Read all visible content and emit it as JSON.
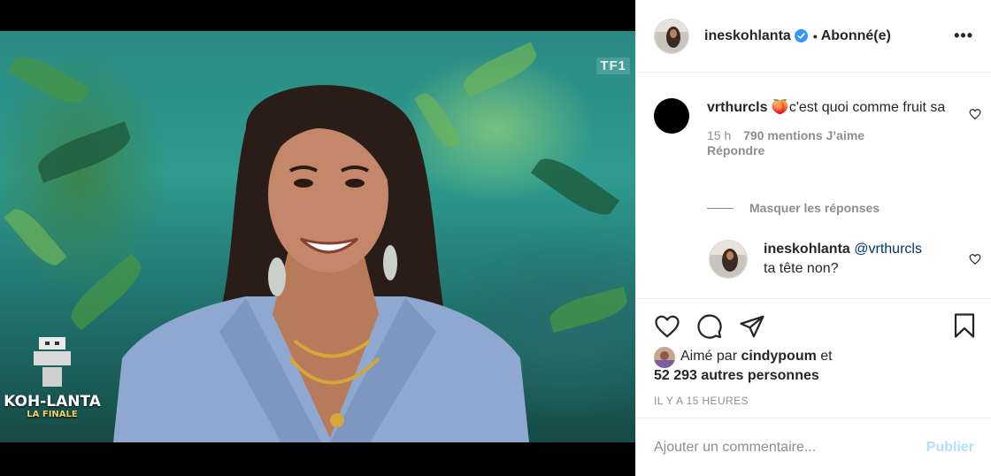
{
  "media": {
    "channel_logo": "TF1",
    "show_title": "KOH-LANTA",
    "show_subtitle": "LA FINALE"
  },
  "header": {
    "username": "ineskohlanta",
    "separator": "•",
    "follow_status": "Abonné(e)",
    "more_label": "•••"
  },
  "comments": [
    {
      "username": "vrthurcls",
      "emoji": "🍑",
      "text": "c'est quoi comme fruit sa",
      "time": "15 h",
      "likes": "790 mentions J’aime",
      "reply_label": "Répondre"
    }
  ],
  "hide_replies_label": "Masquer les réponses",
  "reply": {
    "username": "ineskohlanta",
    "mention": "@vrthurcls",
    "text": "ta tête non?"
  },
  "likes": {
    "prefix": "Aimé par",
    "user": "cindypoum",
    "conjunction": "et",
    "count": "52 293 autres personnes"
  },
  "timestamp": "IL Y A 15 HEURES",
  "add_comment": {
    "placeholder": "Ajouter un commentaire...",
    "publish_label": "Publier"
  },
  "colors": {
    "verified": "#3897f0",
    "publish_disabled": "#b2dffc",
    "text": "#262626",
    "muted": "#8e8e8e",
    "mention": "#00376b"
  }
}
